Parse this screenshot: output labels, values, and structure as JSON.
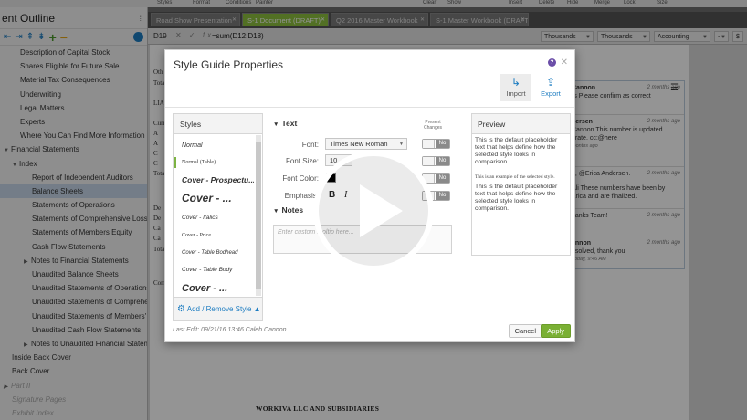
{
  "toolbar": {
    "labels": [
      "Styles",
      "Format",
      "Conditions",
      "Painter",
      "Clear",
      "Show",
      "Insert",
      "Delete",
      "Hide",
      "Merge",
      "Lock",
      "Size"
    ]
  },
  "sidebar": {
    "title": "ent Outline",
    "items": [
      {
        "label": "Description of Capital Stock",
        "indent": 1
      },
      {
        "label": "Shares Eligible for Future Sale",
        "indent": 1
      },
      {
        "label": "Material Tax Consequences",
        "indent": 1
      },
      {
        "label": "Underwriting",
        "indent": 1
      },
      {
        "label": "Legal Matters",
        "indent": 1
      },
      {
        "label": "Experts",
        "indent": 1
      },
      {
        "label": "Where You Can Find More Information",
        "indent": 1
      },
      {
        "label": "Financial Statements",
        "indent": 0,
        "toggle": "▼"
      },
      {
        "label": "Index",
        "indent": 1,
        "toggle": "▼"
      },
      {
        "label": "Report of Independent Auditors",
        "indent": 2
      },
      {
        "label": "Balance Sheets",
        "indent": 2,
        "selected": true
      },
      {
        "label": "Statements of Operations",
        "indent": 2
      },
      {
        "label": "Statements of Comprehensive Loss",
        "indent": 2
      },
      {
        "label": "Statements of Members Equity",
        "indent": 2
      },
      {
        "label": "Cash Flow Statements",
        "indent": 2
      },
      {
        "label": "Notes to Financial Statements",
        "indent": 2,
        "toggle": "▶"
      },
      {
        "label": "Unaudited Balance Sheets",
        "indent": 2
      },
      {
        "label": "Unaudited Statements of Operations",
        "indent": 2
      },
      {
        "label": "Unaudited Statements of Comprehensive",
        "indent": 2
      },
      {
        "label": "Unaudited Statements of Members'",
        "indent": 2
      },
      {
        "label": "Unaudited Cash Flow Statements",
        "indent": 2
      },
      {
        "label": "Notes to Unaudited Financial Statements",
        "indent": 2,
        "toggle": "▶"
      },
      {
        "label": "Inside Back Cover",
        "indent": 0
      },
      {
        "label": "Back Cover",
        "indent": 0
      },
      {
        "label": "Part II",
        "indent": 0,
        "toggle": "▶",
        "dim": true
      },
      {
        "label": "Signature Pages",
        "indent": 0,
        "dim": true
      },
      {
        "label": "Exhibit Index",
        "indent": 0,
        "dim": true
      }
    ]
  },
  "tabs": [
    {
      "label": "Road Show Presentation",
      "active": false
    },
    {
      "label": "S-1 Document (DRAFT)",
      "active": true
    },
    {
      "label": "Q2 2016 Master Workbook",
      "active": false
    },
    {
      "label": "S-1 Master Workbook  (DRAFT)",
      "active": false
    }
  ],
  "formula_bar": {
    "cell": "D19",
    "formula": "=sum(D12:D18)",
    "drops": [
      "Thousands",
      "Thousands",
      "Accounting",
      "-",
      "$"
    ]
  },
  "doc": {
    "row_labels": [
      "Oth",
      "Tota",
      "LIA",
      "Curr",
      "A",
      "A",
      "C",
      "C",
      "Tota",
      "De",
      "De",
      "Ca",
      "Ca",
      "Tota",
      "Com"
    ],
    "footer": "WORKIVA LLC AND SUBSIDIARIES"
  },
  "comments": [
    {
      "who": "Cannon",
      "when": "2 months ago",
      "text": "rs Please confirm as correct"
    },
    {
      "who": "dersen",
      "when": "2 months ago",
      "text": "Cannon This number is updated urate. cc:@here",
      "sub": "months ago"
    },
    {
      "who": "",
      "when": "2 months ago",
      "text": "u, @Erica Andersen."
    },
    {
      "who": "",
      "when": "",
      "text": "Ali These numbers have been by Erica and are finalized."
    },
    {
      "who": "",
      "when": "2 months ago",
      "text": "hanks Team!"
    },
    {
      "who": "annon",
      "when": "2 months ago",
      "text": "esolved, thank you",
      "sub": "Today, 9:46 AM"
    }
  ],
  "modal": {
    "title": "Style Guide Properties",
    "help_icon": "?",
    "import_label": "Import",
    "export_label": "Export",
    "styles_header": "Styles",
    "styles": [
      {
        "label": "Normal",
        "font": "sans",
        "size": 7,
        "style": "italic",
        "weight": "normal"
      },
      {
        "label": "Normal (Table)",
        "font": "serif",
        "size": 6,
        "style": "normal",
        "weight": "normal",
        "selected": true
      },
      {
        "label": "Cover - Prospectu...",
        "font": "sans",
        "size": 8.5,
        "style": "italic",
        "weight": "bold"
      },
      {
        "label": "Cover - ...",
        "font": "sans",
        "size": 12,
        "style": "italic",
        "weight": "bold"
      },
      {
        "label": "Cover - Italics",
        "font": "sans",
        "size": 6.5,
        "style": "italic",
        "weight": "normal"
      },
      {
        "label": "Cover - Price",
        "font": "serif",
        "size": 6,
        "style": "normal",
        "weight": "normal"
      },
      {
        "label": "Cover - Table Bodhead",
        "font": "sans",
        "size": 6,
        "style": "italic",
        "weight": "normal"
      },
      {
        "label": "Cover - Table Body",
        "font": "sans",
        "size": 6.5,
        "style": "italic",
        "weight": "normal"
      },
      {
        "label": "Cover - ...",
        "font": "sans",
        "size": 11,
        "style": "italic",
        "weight": "bold"
      }
    ],
    "add_remove": "Add / Remove Style ▲",
    "text_section": "Text",
    "present_changes": "Present Changes",
    "font_label": "Font:",
    "font_value": "Times New Roman",
    "size_label": "Font Size:",
    "size_value": "10",
    "color_label": "Font Color:",
    "emphasis_label": "Emphasis:",
    "toggle_text": "No",
    "notes_section": "Notes",
    "notes_placeholder": "Enter custom tooltip here...",
    "preview_header": "Preview",
    "preview_para_1": "This is the default placeholder text that helps define how the selected style looks in comparison.",
    "preview_example": "This is an example of the selected style.",
    "preview_para_2": "This is the default placeholder text that helps define how the selected style looks in comparison.",
    "last_edit": "Last Edit: 09/21/16 13:46 Caleb Cannon",
    "cancel": "Cancel",
    "apply": "Apply"
  },
  "colors": {
    "accent_green": "#7ab034",
    "link_blue": "#1c7cc1",
    "help_purple": "#6b4ea8"
  }
}
